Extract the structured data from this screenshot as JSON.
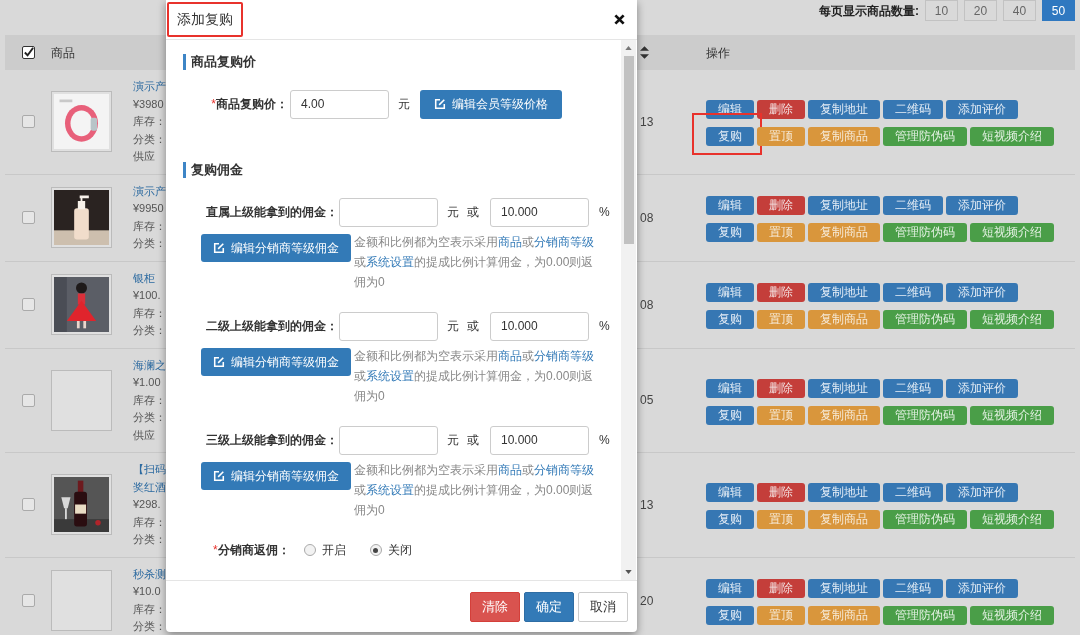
{
  "page_size": {
    "label": "每页显示商品数量:",
    "options": [
      {
        "label": "10",
        "selected": false
      },
      {
        "label": "20",
        "selected": false
      },
      {
        "label": "40",
        "selected": false
      },
      {
        "label": "50",
        "selected": true
      }
    ]
  },
  "table": {
    "select_all_checked": true,
    "columns": [
      "商品",
      "操作"
    ],
    "rows": [
      {
        "checked": false,
        "thumbnail": {
          "kind": "picture"
        },
        "title_lines": [
          "演示产"
        ],
        "info_lines": [
          "¥3980",
          "库存：",
          "分类：",
          "供应"
        ],
        "column_3": "13",
        "actions": [
          [
            {
              "label": "编辑",
              "kind": "primary"
            },
            {
              "label": "删除",
              "kind": "danger"
            },
            {
              "label": "复制地址",
              "kind": "primary"
            },
            {
              "label": "二维码",
              "kind": "primary"
            },
            {
              "label": "添加评价",
              "kind": "primary"
            }
          ],
          [
            {
              "label": "复购",
              "kind": "primary",
              "highlighted": true
            },
            {
              "label": "置顶",
              "kind": "warning"
            },
            {
              "label": "复制商品",
              "kind": "warning"
            },
            {
              "label": "管理防伪码",
              "kind": "success"
            },
            {
              "label": "短视频介绍",
              "kind": "success"
            }
          ]
        ]
      },
      {
        "checked": false,
        "thumbnail": {
          "kind": "picture"
        },
        "title_lines": [
          "演示产"
        ],
        "info_lines": [
          "¥9950",
          "库存：",
          "分类："
        ],
        "column_3": "08",
        "actions": [
          [
            {
              "label": "编辑",
              "kind": "primary"
            },
            {
              "label": "删除",
              "kind": "danger"
            },
            {
              "label": "复制地址",
              "kind": "primary"
            },
            {
              "label": "二维码",
              "kind": "primary"
            },
            {
              "label": "添加评价",
              "kind": "primary"
            }
          ],
          [
            {
              "label": "复购",
              "kind": "primary",
              "highlighted": false
            },
            {
              "label": "置顶",
              "kind": "warning"
            },
            {
              "label": "复制商品",
              "kind": "warning"
            },
            {
              "label": "管理防伪码",
              "kind": "success"
            },
            {
              "label": "短视频介绍",
              "kind": "success"
            }
          ]
        ]
      },
      {
        "checked": false,
        "thumbnail": {
          "kind": "picture"
        },
        "title_lines": [
          "银柜"
        ],
        "info_lines": [
          "¥100.",
          "库存：",
          "分类："
        ],
        "column_3": "08",
        "actions": [
          [
            {
              "label": "编辑",
              "kind": "primary"
            },
            {
              "label": "删除",
              "kind": "danger"
            },
            {
              "label": "复制地址",
              "kind": "primary"
            },
            {
              "label": "二维码",
              "kind": "primary"
            },
            {
              "label": "添加评价",
              "kind": "primary"
            }
          ],
          [
            {
              "label": "复购",
              "kind": "primary",
              "highlighted": false
            },
            {
              "label": "置顶",
              "kind": "warning"
            },
            {
              "label": "复制商品",
              "kind": "warning"
            },
            {
              "label": "管理防伪码",
              "kind": "success"
            },
            {
              "label": "短视频介绍",
              "kind": "success"
            }
          ]
        ]
      },
      {
        "checked": false,
        "thumbnail": {
          "kind": "empty"
        },
        "title_lines": [
          "海澜之"
        ],
        "info_lines": [
          "¥1.00",
          "库存：",
          "分类：",
          "供应"
        ],
        "column_3": "05",
        "actions": [
          [
            {
              "label": "编辑",
              "kind": "primary"
            },
            {
              "label": "删除",
              "kind": "danger"
            },
            {
              "label": "复制地址",
              "kind": "primary"
            },
            {
              "label": "二维码",
              "kind": "primary"
            },
            {
              "label": "添加评价",
              "kind": "primary"
            }
          ],
          [
            {
              "label": "复购",
              "kind": "primary",
              "highlighted": false
            },
            {
              "label": "置顶",
              "kind": "warning"
            },
            {
              "label": "复制商品",
              "kind": "warning"
            },
            {
              "label": "管理防伪码",
              "kind": "success"
            },
            {
              "label": "短视频介绍",
              "kind": "success"
            }
          ]
        ]
      },
      {
        "checked": false,
        "thumbnail": {
          "kind": "picture"
        },
        "title_lines": [
          "【扫码",
          "奖红酒"
        ],
        "info_lines": [
          "¥298.",
          "库存：",
          "分类："
        ],
        "column_3": "13",
        "actions": [
          [
            {
              "label": "编辑",
              "kind": "primary"
            },
            {
              "label": "删除",
              "kind": "danger"
            },
            {
              "label": "复制地址",
              "kind": "primary"
            },
            {
              "label": "二维码",
              "kind": "primary"
            },
            {
              "label": "添加评价",
              "kind": "primary"
            }
          ],
          [
            {
              "label": "复购",
              "kind": "primary",
              "highlighted": false
            },
            {
              "label": "置顶",
              "kind": "warning"
            },
            {
              "label": "复制商品",
              "kind": "warning"
            },
            {
              "label": "管理防伪码",
              "kind": "success"
            },
            {
              "label": "短视频介绍",
              "kind": "success"
            }
          ]
        ]
      },
      {
        "checked": false,
        "thumbnail": {
          "kind": "empty"
        },
        "title_lines": [
          "秒杀测"
        ],
        "info_lines": [
          "¥10.0",
          "库存：",
          "分类："
        ],
        "column_3": "20",
        "actions": [
          [
            {
              "label": "编辑",
              "kind": "primary"
            },
            {
              "label": "删除",
              "kind": "danger"
            },
            {
              "label": "复制地址",
              "kind": "primary"
            },
            {
              "label": "二维码",
              "kind": "primary"
            },
            {
              "label": "添加评价",
              "kind": "primary"
            }
          ],
          [
            {
              "label": "复购",
              "kind": "primary",
              "highlighted": false
            },
            {
              "label": "置顶",
              "kind": "warning"
            },
            {
              "label": "复制商品",
              "kind": "warning"
            },
            {
              "label": "管理防伪码",
              "kind": "success"
            },
            {
              "label": "短视频介绍",
              "kind": "success"
            }
          ]
        ]
      }
    ]
  },
  "dialog": {
    "title": "添加复购",
    "title_highlighted": true,
    "price_section": {
      "title": "商品复购价",
      "required_mark": "*",
      "label": "商品复购价：",
      "value": "4.00",
      "unit": "元",
      "button": "编辑会员等级价格"
    },
    "commission_section": {
      "title": "复购佣金",
      "levels": [
        {
          "label": "直属上级能拿到的佣金：",
          "unit": "元",
          "or": "或",
          "percent": "10.000",
          "percent_unit": "%",
          "button": "编辑分销商等级佣金",
          "hint": [
            {
              "text": "金额和比例都为空表示采用",
              "kind": "text"
            },
            {
              "text": "商品",
              "kind": "link"
            },
            {
              "text": "或",
              "kind": "text"
            },
            {
              "text": "分销商等级",
              "kind": "link"
            },
            {
              "text": "或",
              "kind": "text"
            },
            {
              "text": "系统设置",
              "kind": "link"
            },
            {
              "text": "的提成比例计算佣金，为0.00则返佣为0",
              "kind": "text"
            }
          ]
        },
        {
          "label": "二级上级能拿到的佣金：",
          "unit": "元",
          "or": "或",
          "percent": "10.000",
          "percent_unit": "%",
          "button": "编辑分销商等级佣金",
          "hint": [
            {
              "text": "金额和比例都为空表示采用",
              "kind": "text"
            },
            {
              "text": "商品",
              "kind": "link"
            },
            {
              "text": "或",
              "kind": "text"
            },
            {
              "text": "分销商等级",
              "kind": "link"
            },
            {
              "text": "或",
              "kind": "text"
            },
            {
              "text": "系统设置",
              "kind": "link"
            },
            {
              "text": "的提成比例计算佣金，为0.00则返佣为0",
              "kind": "text"
            }
          ]
        },
        {
          "label": "三级上级能拿到的佣金：",
          "unit": "元",
          "or": "或",
          "percent": "10.000",
          "percent_unit": "%",
          "button": "编辑分销商等级佣金",
          "hint": [
            {
              "text": "金额和比例都为空表示采用",
              "kind": "text"
            },
            {
              "text": "商品",
              "kind": "link"
            },
            {
              "text": "或",
              "kind": "text"
            },
            {
              "text": "分销商等级",
              "kind": "link"
            },
            {
              "text": "或",
              "kind": "text"
            },
            {
              "text": "系统设置",
              "kind": "link"
            },
            {
              "text": "的提成比例计算佣金，为0.00则返佣为0",
              "kind": "text"
            }
          ]
        }
      ]
    },
    "rebate": {
      "required_mark": "*",
      "label": "分销商返佣：",
      "options": [
        {
          "label": "开启",
          "selected": false
        },
        {
          "label": "关闭",
          "selected": true
        }
      ]
    },
    "footer_buttons": [
      {
        "label": "清除",
        "kind": "danger"
      },
      {
        "label": "确定",
        "kind": "primary"
      },
      {
        "label": "取消",
        "kind": "default"
      }
    ]
  }
}
